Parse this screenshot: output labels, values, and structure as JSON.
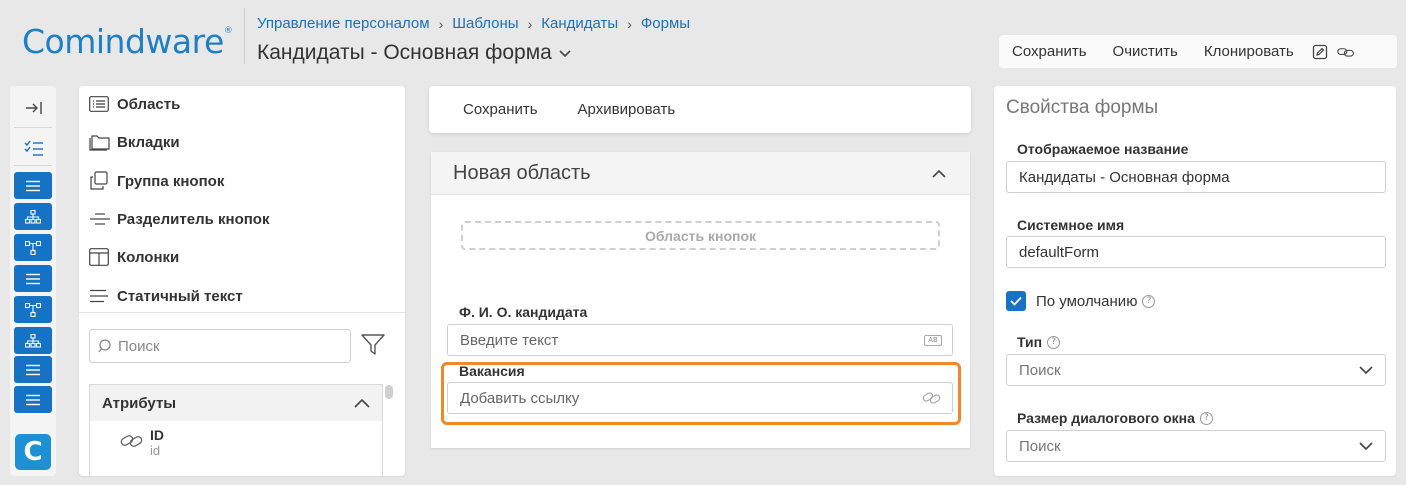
{
  "logo": {
    "text": "Comindware",
    "reg": "®"
  },
  "breadcrumb": [
    "Управление персоналом",
    "Шаблоны",
    "Кандидаты",
    "Формы"
  ],
  "page_title": "Кандидаты - Основная форма",
  "top_toolbar": {
    "save": "Сохранить",
    "clear": "Очистить",
    "clone": "Клонировать"
  },
  "rail": {
    "app_letter": "C"
  },
  "components": [
    {
      "label": "Область",
      "icon": "list-icon"
    },
    {
      "label": "Вкладки",
      "icon": "folder-icon"
    },
    {
      "label": "Группа кнопок",
      "icon": "copy-icon"
    },
    {
      "label": "Разделитель кнопок",
      "icon": "separator-icon"
    },
    {
      "label": "Колонки",
      "icon": "columns-icon"
    },
    {
      "label": "Статичный текст",
      "icon": "text-lines-icon"
    }
  ],
  "search": {
    "placeholder": "Поиск"
  },
  "attributes": {
    "title": "Атрибуты",
    "items": [
      {
        "name": "ID",
        "system": "id"
      }
    ]
  },
  "center_toolbar": {
    "save": "Сохранить",
    "archive": "Архивировать"
  },
  "form_area": {
    "title": "Новая область",
    "button_area": "Область кнопок",
    "fields": [
      {
        "label": "Ф. И. О. кандидата",
        "placeholder": "Введите текст",
        "badge": "AB"
      },
      {
        "label": "Вакансия",
        "placeholder": "Добавить ссылку"
      }
    ],
    "highlight_color": "#f0882a"
  },
  "properties": {
    "title": "Свойства формы",
    "display_name_label": "Отображаемое название",
    "display_name_value": "Кандидаты - Основная форма",
    "system_name_label": "Системное имя",
    "system_name_value": "defaultForm",
    "default_label": "По умолчанию",
    "default_checked": true,
    "type_label": "Тип",
    "type_placeholder": "Поиск",
    "dialog_size_label": "Размер диалогового окна",
    "dialog_size_placeholder": "Поиск"
  },
  "colors": {
    "accent": "#1572c4",
    "brand": "#1e7fc4",
    "highlight": "#f0882a"
  }
}
